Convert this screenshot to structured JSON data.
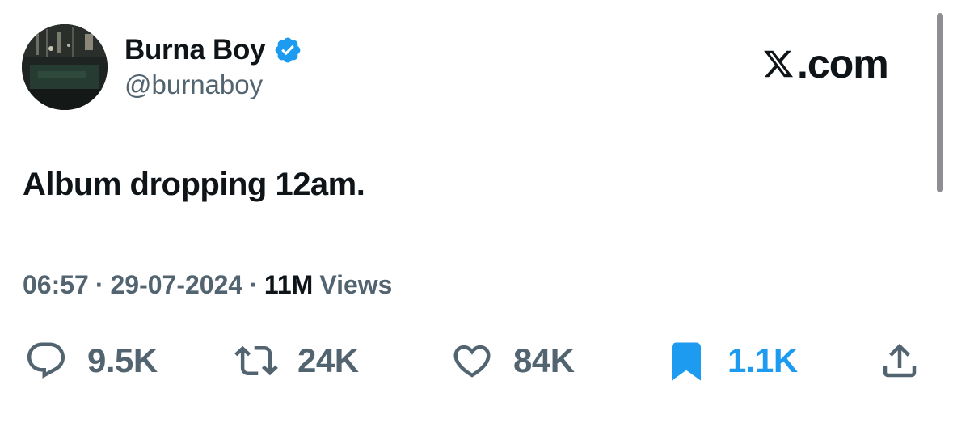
{
  "author": {
    "display_name": "Burna Boy",
    "handle": "@burnaboy",
    "verified": true,
    "verified_color": "#1d9bf0"
  },
  "brand": {
    "text": ".com",
    "icon": "x-logo-icon"
  },
  "tweet": {
    "text": "Album dropping 12am."
  },
  "meta": {
    "time": "06:57",
    "separator": "·",
    "date": "29-07-2024",
    "views_count": "11M",
    "views_label": "Views"
  },
  "actions": {
    "replies": {
      "icon": "reply-icon",
      "count": "9.5K"
    },
    "reposts": {
      "icon": "repost-icon",
      "count": "24K"
    },
    "likes": {
      "icon": "heart-icon",
      "count": "84K"
    },
    "bookmarks": {
      "icon": "bookmark-icon",
      "count": "1.1K",
      "active": true,
      "color": "#1d9bf0"
    },
    "share": {
      "icon": "share-icon"
    }
  },
  "colors": {
    "text_primary": "#0f1419",
    "text_secondary": "#536471",
    "accent": "#1d9bf0"
  }
}
